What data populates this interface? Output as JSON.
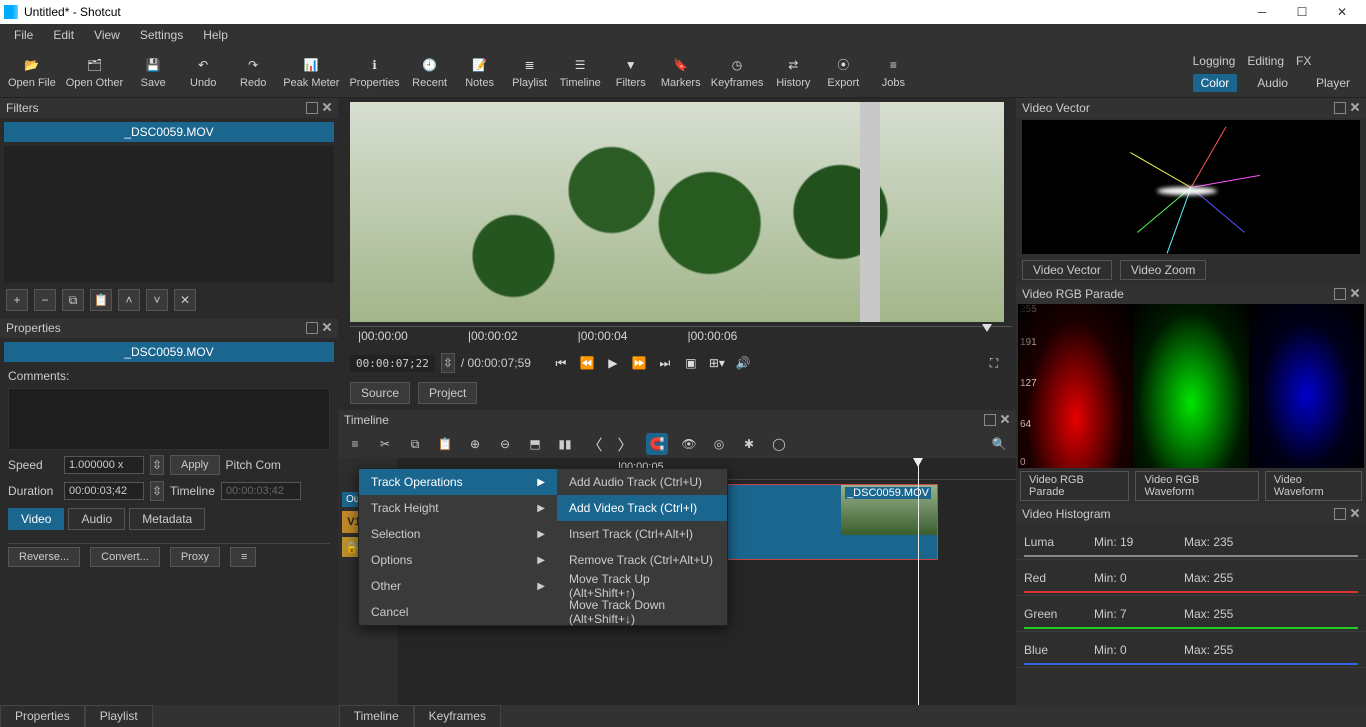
{
  "window": {
    "title": "Untitled* - Shotcut"
  },
  "menu": {
    "file": "File",
    "edit": "Edit",
    "view": "View",
    "settings": "Settings",
    "help": "Help"
  },
  "toolbar": {
    "open_file": "Open File",
    "open_other": "Open Other",
    "save": "Save",
    "undo": "Undo",
    "redo": "Redo",
    "peak_meter": "Peak Meter",
    "properties": "Properties",
    "recent": "Recent",
    "notes": "Notes",
    "playlist": "Playlist",
    "timeline": "Timeline",
    "filters": "Filters",
    "markers": "Markers",
    "keyframes": "Keyframes",
    "history": "History",
    "export": "Export",
    "jobs": "Jobs"
  },
  "top_tabs": {
    "logging": "Logging",
    "editing": "Editing",
    "fx": "FX"
  },
  "mode_tabs": {
    "color": "Color",
    "audio": "Audio",
    "player": "Player"
  },
  "filters_panel": {
    "title": "Filters",
    "clip": "_DSC0059.MOV"
  },
  "preview": {
    "ruler": [
      "|00:00:00",
      "|00:00:02",
      "|00:00:04",
      "|00:00:06"
    ],
    "tc_in": "00:00:07;22",
    "tc_out": "/ 00:00:07;59",
    "tabs": {
      "source": "Source",
      "project": "Project"
    }
  },
  "properties": {
    "title": "Properties",
    "clip": "_DSC0059.MOV",
    "comments_label": "Comments:",
    "speed_label": "Speed",
    "speed_value": "1.000000 x",
    "apply": "Apply",
    "pitch": "Pitch Com",
    "duration_label": "Duration",
    "duration_value": "00:00:03;42",
    "timeline_label": "Timeline",
    "timeline_value": "00:00:03;42",
    "tabs": {
      "video": "Video",
      "audio": "Audio",
      "metadata": "Metadata"
    },
    "buttons": {
      "reverse": "Reverse...",
      "convert": "Convert...",
      "proxy": "Proxy"
    }
  },
  "timeline": {
    "title": "Timeline",
    "tick": "|00:00:05",
    "clip_name": "_DSC0059.MOV",
    "track_badge": "V1",
    "out_label": "Ou"
  },
  "context_menu": {
    "left": [
      "Track Operations",
      "Track Height",
      "Selection",
      "Options",
      "Other",
      "Cancel"
    ],
    "right": [
      "Add Audio Track (Ctrl+U)",
      "Add Video Track (Ctrl+I)",
      "Insert Track (Ctrl+Alt+I)",
      "Remove Track (Ctrl+Alt+U)",
      "Move Track Up (Alt+Shift+↑)",
      "Move Track Down (Alt+Shift+↓)"
    ],
    "highlight_left": 0,
    "highlight_right": 1
  },
  "video_vector": {
    "title": "Video Vector",
    "tabs": {
      "vector": "Video Vector",
      "zoom": "Video Zoom"
    }
  },
  "parade": {
    "title": "Video RGB Parade",
    "ylabels": [
      "255",
      "191",
      "127",
      "64",
      "0"
    ],
    "tabs": [
      "Video RGB Parade",
      "Video RGB Waveform",
      "Video Waveform"
    ]
  },
  "histogram": {
    "title": "Video Histogram",
    "rows": [
      {
        "name": "Luma",
        "min": "Min: 19",
        "max": "Max: 235",
        "color": "#888"
      },
      {
        "name": "Red",
        "min": "Min: 0",
        "max": "Max: 255",
        "color": "#d33"
      },
      {
        "name": "Green",
        "min": "Min: 7",
        "max": "Max: 255",
        "color": "#2c2"
      },
      {
        "name": "Blue",
        "min": "Min: 0",
        "max": "Max: 255",
        "color": "#36d"
      }
    ]
  },
  "bottom_tabs": {
    "properties": "Properties",
    "playlist": "Playlist",
    "timeline": "Timeline",
    "keyframes": "Keyframes"
  }
}
